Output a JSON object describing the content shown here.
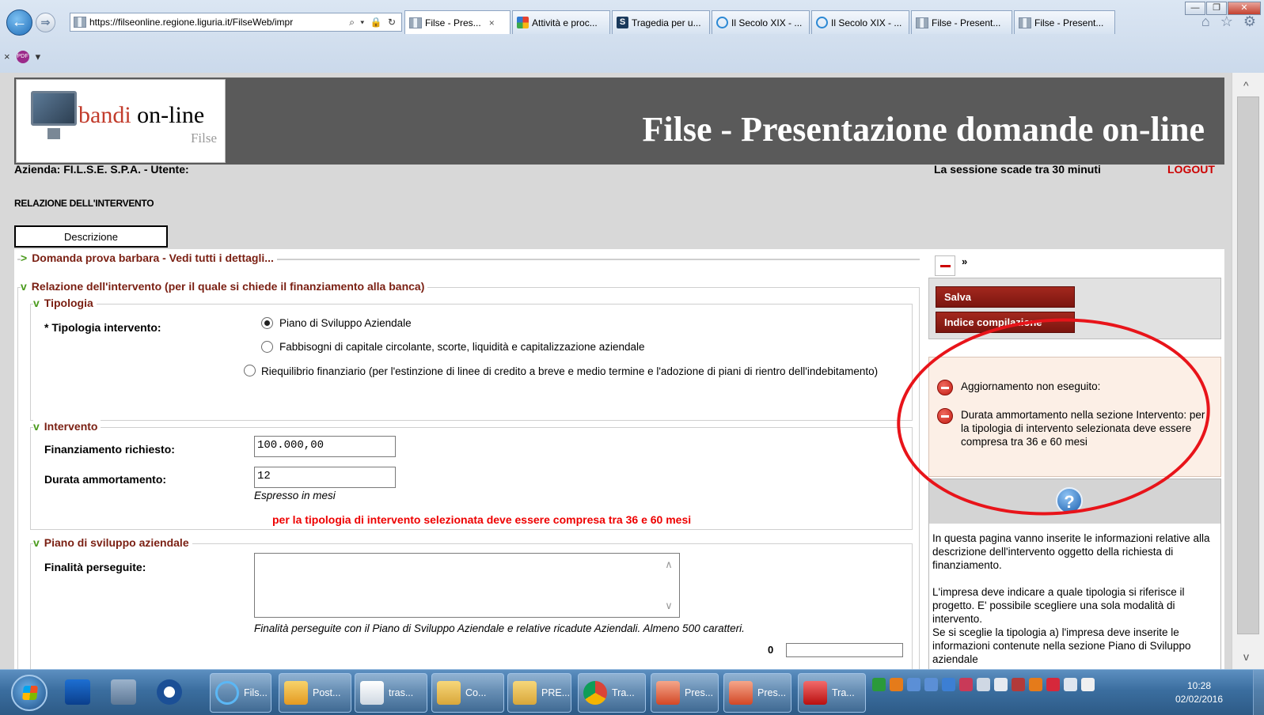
{
  "browser": {
    "url": "https://filseonline.regione.liguria.it/FilseWeb/impr",
    "address_tools": "⌕ ▾ 🔒 ↻",
    "tabs": [
      {
        "label": "Filse - Pres...",
        "icon": "filse-icon",
        "active": true
      },
      {
        "label": "Attività e proc...",
        "icon": "activity-icon"
      },
      {
        "label": "Tragedia per u...",
        "icon": "s-news-icon"
      },
      {
        "label": "Il Secolo XIX - ...",
        "icon": "ie-icon"
      },
      {
        "label": "Il Secolo XIX - ...",
        "icon": "ie-icon"
      },
      {
        "label": "Filse - Present...",
        "icon": "filse-icon"
      },
      {
        "label": "Filse - Present...",
        "icon": "filse-icon"
      }
    ],
    "tab_close": "×",
    "cmdbar_close": "×",
    "cmdbar_pdf_label": "PDF",
    "right_icons": "⌂ ☆ ⚙"
  },
  "header": {
    "logo_main_a": "bandi",
    "logo_main_b": " on-line",
    "logo_sub": "Filse",
    "title": "Filse - Presentazione domande on-line"
  },
  "user_bar": {
    "azienda": "Azienda: FI.L.S.E. S.P.A. - Utente:",
    "session": "La sessione scade tra 30 minuti",
    "logout": "LOGOUT"
  },
  "page_title": "RELAZIONE DELL'INTERVENTO",
  "tab_label": "Descrizione",
  "sections": {
    "domanda": "Domanda prova barbara - Vedi tutti i dettagli...",
    "relazione": "Relazione dell'intervento (per il quale si chiede il finanziamento alla banca)",
    "tipologia": "Tipologia",
    "intervento": "Intervento",
    "piano": "Piano di sviluppo aziendale"
  },
  "chevrons": {
    "collapsed": ">",
    "expanded": "v"
  },
  "tipologia": {
    "label": "* Tipologia intervento:",
    "options": [
      {
        "label": "Piano di Sviluppo Aziendale",
        "selected": true
      },
      {
        "label": "Fabbisogni di capitale circolante, scorte, liquidità  e capitalizzazione aziendale",
        "selected": false
      },
      {
        "label": "Riequilibrio finanziario (per l'estinzione di linee di credito a breve e medio termine e l'adozione di piani di rientro dell'indebitamento)",
        "selected": false
      }
    ]
  },
  "intervento": {
    "finanziamento_label": "Finanziamento richiesto:",
    "finanziamento_value": "100.000,00",
    "durata_label": "Durata ammortamento:",
    "durata_value": "12",
    "durata_hint": "Espresso in mesi",
    "error": "per la tipologia di intervento selezionata deve essere compresa tra 36 e 60 mesi"
  },
  "piano": {
    "finalita_label": "Finalità perseguite:",
    "finalita_value": "",
    "finalita_hint": "Finalità perseguite con il Piano di Sviluppo Aziendale e relative ricadute Aziendali. Almeno 500 caratteri.",
    "char_count": "0",
    "scroll_up": "∧",
    "scroll_down": "∨"
  },
  "side_panel": {
    "collapse_arrow": "»",
    "save": "Salva",
    "index": "Indice compilazione",
    "messages": [
      "Aggiornamento non eseguito:",
      "Durata ammortamento nella sezione Intervento: per la tipologia di intervento selezionata deve essere compresa tra 36 e 60 mesi"
    ],
    "help_icon_glyph": "?",
    "help": [
      "In questa pagina vanno inserite le informazioni relative alla descrizione dell'intervento oggetto della richiesta di finanziamento.",
      "L'impresa deve indicare a quale tipologia si riferisce il progetto. E' possibile scegliere una sola modalità di intervento.",
      "Se si sceglie la tipologia a) l'impresa deve inserite le informazioni contenute nella sezione Piano di Sviluppo aziendale"
    ]
  },
  "scrollbar": {
    "up": "^",
    "down": "v"
  },
  "window_buttons": {
    "minimize": "—",
    "restore": "❐",
    "close": "✕"
  },
  "taskbar": {
    "tasks": [
      "Fils...",
      "Post...",
      "tras...",
      "Co...",
      "PRE...",
      "Tra...",
      "Pres...",
      "Pres...",
      "Tra..."
    ],
    "time": "10:28",
    "date": "02/02/2016"
  },
  "colors": {
    "accent_red": "#7a1f12",
    "error_red": "#e00000",
    "header_bg": "#5a5a5a",
    "annotation": "#e8141a"
  }
}
